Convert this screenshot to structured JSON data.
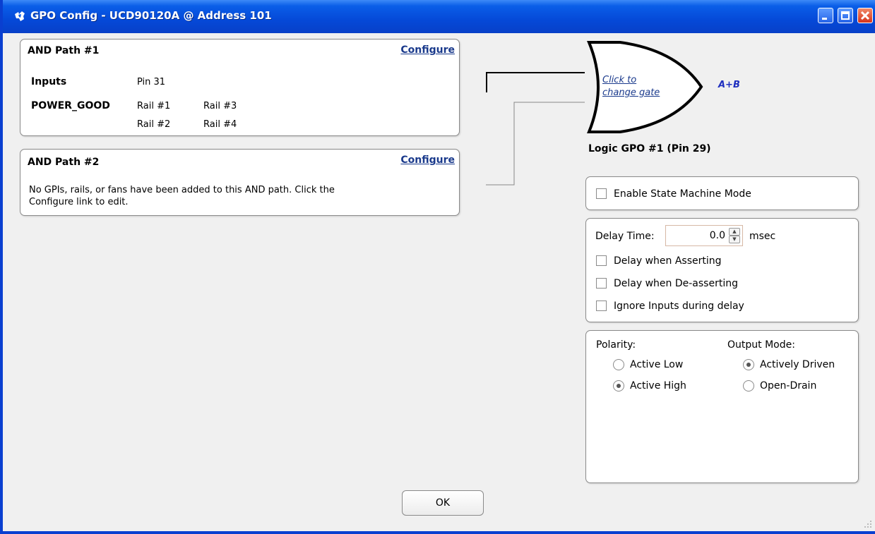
{
  "window": {
    "title": "GPO Config - UCD90120A @ Address 101",
    "icon": "ti-logo-icon",
    "controls": [
      "minimize",
      "maximize",
      "close"
    ]
  },
  "and_path_1": {
    "title": "AND Path #1",
    "configure_label": "Configure",
    "inputs_label": "Inputs",
    "inputs_value": "Pin 31",
    "power_good_label": "POWER_GOOD",
    "rails": [
      "Rail #1",
      "Rail #3",
      "Rail #2",
      "Rail #4"
    ]
  },
  "and_path_2": {
    "title": "AND Path #2",
    "configure_label": "Configure",
    "message_line1": "No GPIs, rails, or fans have been added to this AND path. Click the",
    "message_line2": "Configure link to edit."
  },
  "gate": {
    "link_line1": "Click to",
    "link_line2": "change gate",
    "expression": "A+B",
    "output_label": "Logic GPO #1 (Pin 29)"
  },
  "state_machine": {
    "label": "Enable State Machine Mode",
    "checked": false
  },
  "delay": {
    "label": "Delay Time:",
    "value": "0.0",
    "unit": "msec",
    "options": [
      {
        "label": "Delay when Asserting",
        "checked": false
      },
      {
        "label": "Delay when De-asserting",
        "checked": false
      },
      {
        "label": "Ignore Inputs during delay",
        "checked": false
      }
    ]
  },
  "polarity": {
    "label": "Polarity:",
    "options": [
      "Active Low",
      "Active High"
    ],
    "selected": "Active High"
  },
  "output_mode": {
    "label": "Output Mode:",
    "options": [
      "Actively Driven",
      "Open-Drain"
    ],
    "selected": "Actively Driven"
  },
  "ok_label": "OK",
  "colors": {
    "titlebar": "#0a5ee8",
    "link": "#1a3a8c",
    "expression": "#1f2fbf"
  }
}
